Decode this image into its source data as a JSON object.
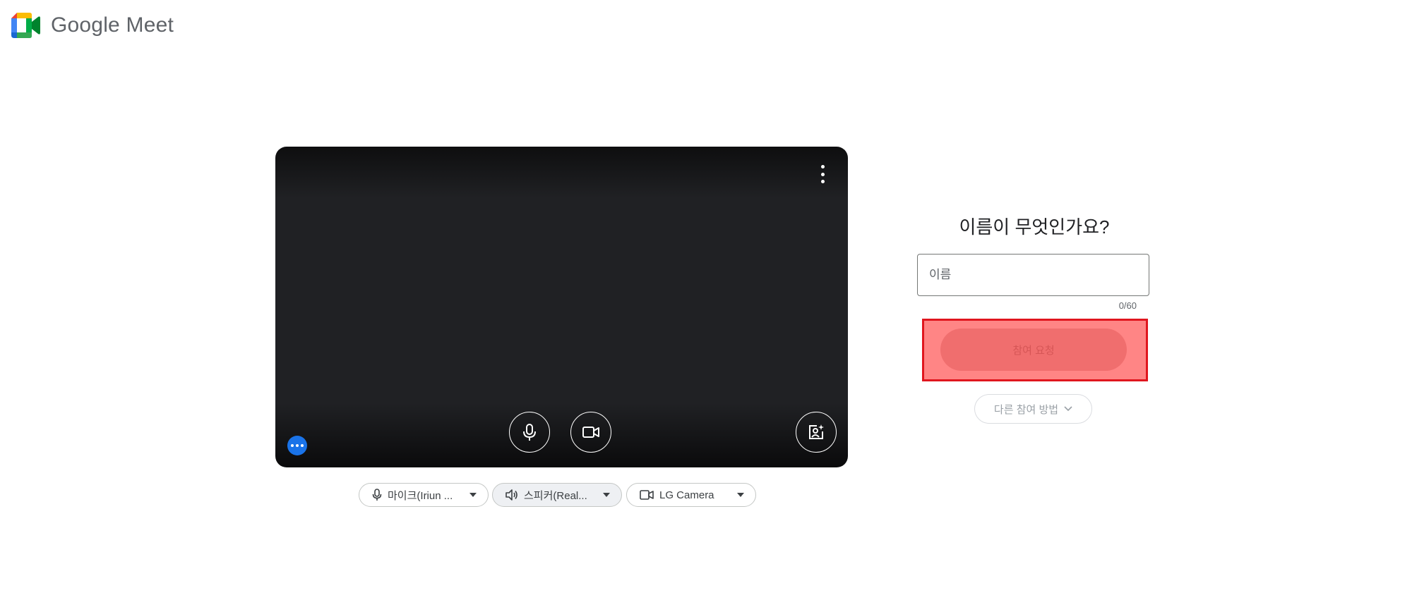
{
  "header": {
    "logo_icon": "google-meet-logo-icon",
    "brand_google": "Google",
    "brand_meet": "Meet"
  },
  "preview": {
    "menu_icon": "more-vert-icon",
    "mic_icon": "mic-icon",
    "camera_icon": "videocam-icon",
    "effects_icon": "visual-effects-icon",
    "more_options_icon": "more-horiz-icon"
  },
  "devices": {
    "microphone": {
      "label": "마이크(Iriun ...",
      "icon": "mic-icon"
    },
    "speaker": {
      "label": "스피커(Real...",
      "icon": "volume-icon"
    },
    "camera": {
      "label": "LG Camera",
      "icon": "videocam-icon"
    }
  },
  "join": {
    "title": "이름이 무엇인가요?",
    "name_placeholder": "이름",
    "name_value": "",
    "char_count": "0/60",
    "ask_to_join_label": "참여 요청",
    "other_ways_label": "다른 참여 방법"
  },
  "colors": {
    "accent_blue": "#1a73e8",
    "highlight_border": "#e0161e",
    "highlight_fill": "#ff8585"
  }
}
